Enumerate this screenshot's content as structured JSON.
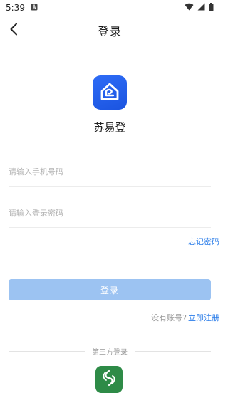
{
  "status_bar": {
    "time": "5:39",
    "icons": [
      "notification-a-icon",
      "wifi-icon",
      "signal-icon",
      "battery-icon"
    ]
  },
  "header": {
    "title": "登录",
    "back_icon": "chevron-left-icon"
  },
  "app": {
    "name": "苏易登",
    "logo_icon": "house-logo-icon",
    "brand_color": "#1b54e0"
  },
  "form": {
    "phone_placeholder": "请输入手机号码",
    "phone_value": "",
    "password_placeholder": "请输入登录密码",
    "password_value": "",
    "forgot_password": "忘记密码",
    "login_button": "登录",
    "login_button_color": "#9cc3f2"
  },
  "register": {
    "prompt": "没有账号?",
    "link": "立即注册",
    "link_color": "#2b7de9"
  },
  "third_party": {
    "label": "第三方登录",
    "icon": "green-leaf-logo-icon",
    "icon_color": "#2e8b47"
  }
}
